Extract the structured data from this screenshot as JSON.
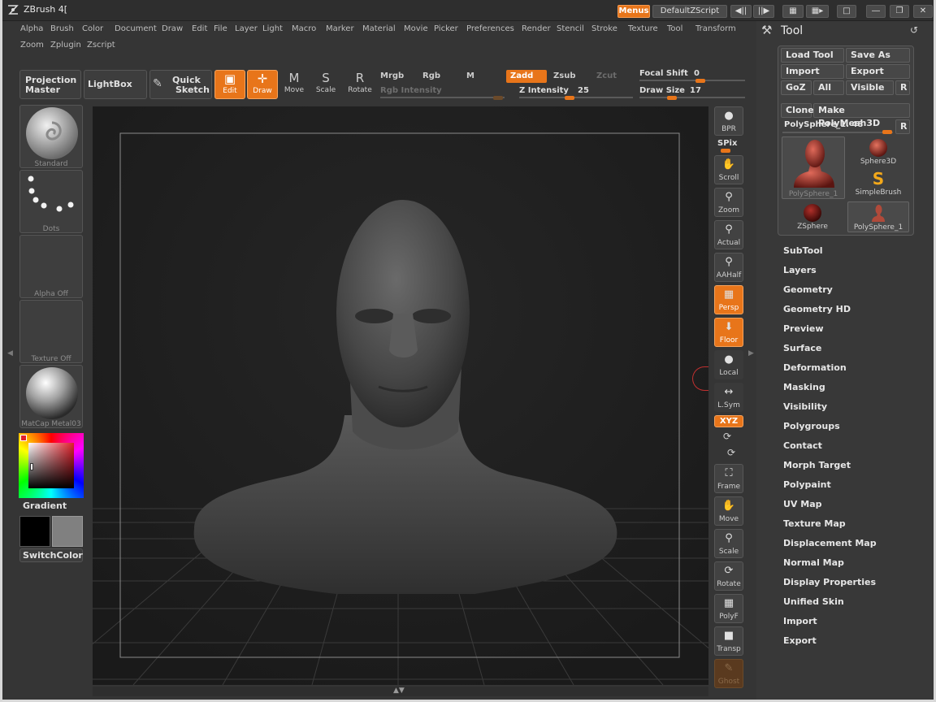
{
  "app": {
    "title": "ZBrush 4[",
    "menus_label": "Menus",
    "script_label": "DefaultZScript"
  },
  "menubar": {
    "row1": [
      "Alpha",
      "Brush",
      "Color",
      "Document",
      "Draw",
      "Edit",
      "File",
      "Layer",
      "Light",
      "Macro",
      "Marker",
      "Material",
      "Movie",
      "Picker",
      "Preferences",
      "Render",
      "Stencil",
      "Stroke",
      "Texture",
      "Tool",
      "Transform"
    ],
    "row2": [
      "Zoom",
      "Zplugin",
      "Zscript"
    ]
  },
  "toolbar": {
    "projection_master": "Projection Master",
    "lightbox": "LightBox",
    "quick_sketch_l1": "Quick",
    "quick_sketch_l2": "Sketch",
    "edit": "Edit",
    "draw": "Draw",
    "move": "Move",
    "scale": "Scale",
    "rotate": "Rotate",
    "move_glyph": "M",
    "scale_glyph": "S",
    "rotate_glyph": "R",
    "mrgb": "Mrgb",
    "rgb": "Rgb",
    "m": "M",
    "zadd": "Zadd",
    "zsub": "Zsub",
    "zcut": "Zcut",
    "rgb_intensity": "Rgb Intensity",
    "z_intensity_label": "Z Intensity",
    "z_intensity_value": "25",
    "focal_shift_label": "Focal Shift",
    "focal_shift_value": "0",
    "draw_size_label": "Draw Size",
    "draw_size_value": "17"
  },
  "left": {
    "brush": "Standard",
    "stroke": "Dots",
    "alpha": "Alpha Off",
    "texture": "Texture Off",
    "material": "MatCap Metal03",
    "gradient": "Gradient",
    "switch_color": "SwitchColor"
  },
  "right_strip": {
    "bpr": "BPR",
    "spix": "SPix",
    "scroll": "Scroll",
    "zoom": "Zoom",
    "actual": "Actual",
    "aahalf": "AAHalf",
    "persp": "Persp",
    "floor": "Floor",
    "local": "Local",
    "lsym": "L.Sym",
    "xyz": "XYZ",
    "frame": "Frame",
    "move": "Move",
    "scale": "Scale",
    "rotate": "Rotate",
    "polyf": "PolyF",
    "transp": "Transp",
    "ghost": "Ghost"
  },
  "tool_panel": {
    "title": "Tool",
    "load_tool": "Load Tool",
    "save_as": "Save As",
    "import": "Import",
    "export": "Export",
    "goz": "GoZ",
    "all": "All",
    "visible": "Visible",
    "r": "R",
    "clone": "Clone",
    "make_polymesh": "Make PolyMesh3D",
    "current_tool": "PolySphere_1. 48",
    "thumbs": [
      "PolySphere_1",
      "Sphere3D",
      "SimpleBrush",
      "ZSphere",
      "PolySphere_1"
    ],
    "subpalettes": [
      "SubTool",
      "Layers",
      "Geometry",
      "Geometry HD",
      "Preview",
      "Surface",
      "Deformation",
      "Masking",
      "Visibility",
      "Polygroups",
      "Contact",
      "Morph Target",
      "Polypaint",
      "UV Map",
      "Texture Map",
      "Displacement Map",
      "Normal Map",
      "Display Properties",
      "Unified Skin",
      "Import",
      "Export"
    ]
  },
  "colors": {
    "accent": "#e8751a",
    "background": "#353535",
    "viewport": "#1f1f1f"
  }
}
